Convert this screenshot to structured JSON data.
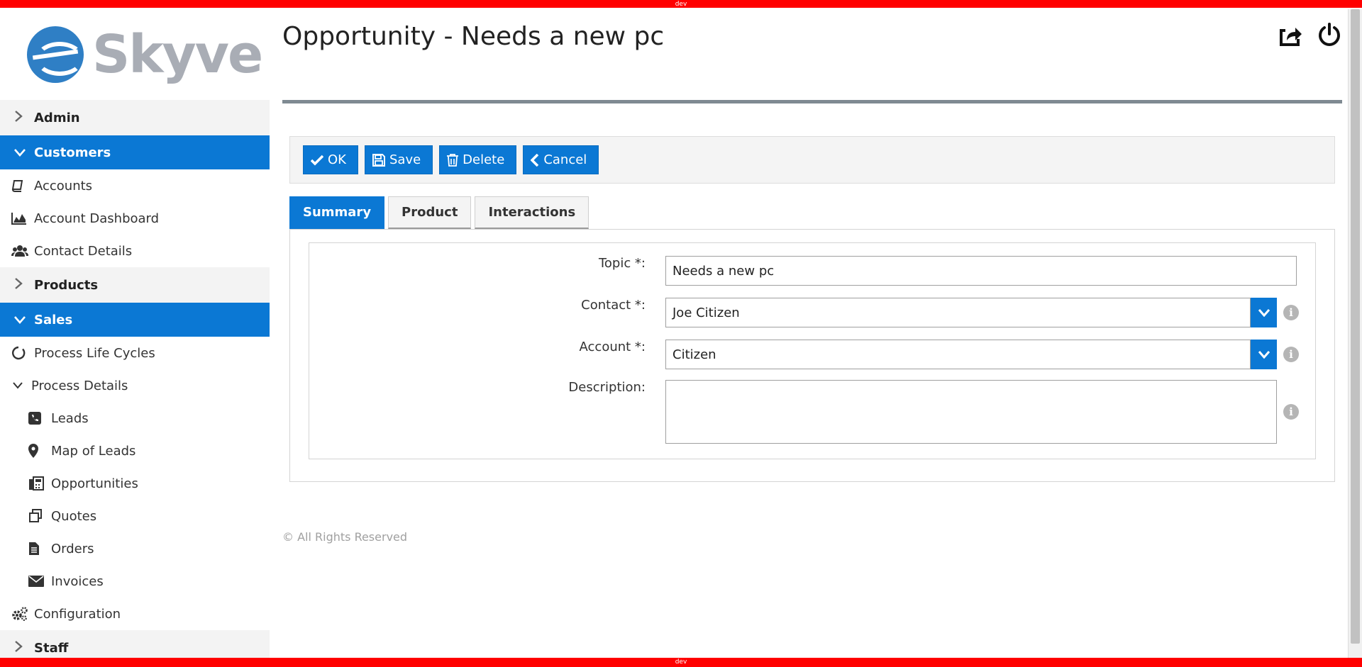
{
  "env_label": "dev",
  "brand": {
    "name": "Skyve"
  },
  "sidebar": {
    "groups": [
      {
        "label": "Admin"
      },
      {
        "label": "Customers",
        "items": [
          {
            "label": "Accounts",
            "icon": "book-icon"
          },
          {
            "label": "Account Dashboard",
            "icon": "area-chart-icon"
          },
          {
            "label": "Contact Details",
            "icon": "users-icon"
          }
        ]
      },
      {
        "label": "Products"
      },
      {
        "label": "Sales",
        "items": [
          {
            "label": "Process Life Cycles",
            "icon": "circle-notch-icon"
          },
          {
            "label": "Process Details",
            "icon": "chevron-down-icon"
          },
          {
            "label": "Leads",
            "icon": "phone-icon"
          },
          {
            "label": "Map of Leads",
            "icon": "map-marker-icon"
          },
          {
            "label": "Opportunities",
            "icon": "fax-icon"
          },
          {
            "label": "Quotes",
            "icon": "copy-icon"
          },
          {
            "label": "Orders",
            "icon": "file-text-icon"
          },
          {
            "label": "Invoices",
            "icon": "envelope-icon"
          },
          {
            "label": "Configuration",
            "icon": "cogs-icon"
          }
        ]
      },
      {
        "label": "Staff"
      }
    ]
  },
  "header": {
    "title": "Opportunity - Needs a new pc"
  },
  "toolbar": {
    "ok_label": "OK",
    "save_label": "Save",
    "delete_label": "Delete",
    "cancel_label": "Cancel"
  },
  "tabs": [
    {
      "label": "Summary",
      "active": true
    },
    {
      "label": "Product",
      "active": false
    },
    {
      "label": "Interactions",
      "active": false
    }
  ],
  "form": {
    "topic_label": "Topic *:",
    "topic_value": "Needs a new pc",
    "contact_label": "Contact *:",
    "contact_value": "Joe Citizen",
    "account_label": "Account *:",
    "account_value": "Citizen",
    "description_label": "Description:",
    "description_value": ""
  },
  "footer": {
    "text": "© All Rights Reserved"
  },
  "colors": {
    "accent": "#0b78d4",
    "dev_bar": "#ff0000",
    "rule": "#7f8a92"
  }
}
